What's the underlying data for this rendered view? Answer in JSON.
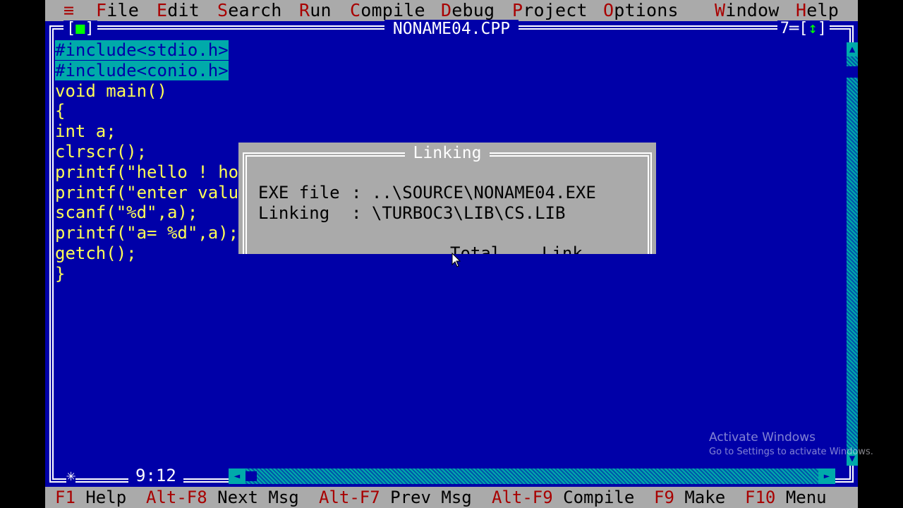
{
  "menu": {
    "system": "≡",
    "items": [
      {
        "hot": "F",
        "rest": "ile"
      },
      {
        "hot": "E",
        "rest": "dit"
      },
      {
        "hot": "S",
        "rest": "earch"
      },
      {
        "hot": "R",
        "rest": "un"
      },
      {
        "hot": "C",
        "rest": "ompile"
      },
      {
        "hot": "D",
        "rest": "ebug"
      },
      {
        "hot": "P",
        "rest": "roject"
      },
      {
        "hot": "O",
        "rest": "ptions"
      },
      {
        "hot": "W",
        "rest": "indow"
      },
      {
        "hot": "H",
        "rest": "elp"
      }
    ]
  },
  "editor": {
    "title": "NONAME04.CPP",
    "close_box": "■",
    "window_number": "7",
    "zoom_icon": "↕",
    "cursor_position": "9:12",
    "code_lines": [
      "#include<stdio.h>",
      "#include<conio.h>",
      "void main()",
      "{",
      "int a;",
      "clrscr();",
      "printf(\"hello ! ho",
      "printf(\"enter valu",
      "scanf(\"%d\",a);",
      "printf(\"a= %d\",a);",
      "getch();",
      "}"
    ]
  },
  "dialog": {
    "title": "Linking",
    "exe_label": "EXE file",
    "exe_value": "..\\SOURCE\\NONAME04.EXE",
    "linking_label": "Linking",
    "linking_value": "\\TURBOC3\\LIB\\CS.LIB",
    "separator": ":",
    "col_total": "Total",
    "col_link": "Link"
  },
  "statusbar": [
    {
      "key": "F1",
      "label": "Help"
    },
    {
      "key": "Alt-F8",
      "label": "Next Msg"
    },
    {
      "key": "Alt-F7",
      "label": "Prev Msg"
    },
    {
      "key": "Alt-F9",
      "label": "Compile"
    },
    {
      "key": "F9",
      "label": "Make"
    },
    {
      "key": "F10",
      "label": "Menu"
    }
  ],
  "watermark": {
    "line1": "Activate Windows",
    "line2": "Go to Settings to activate Windows."
  },
  "colors": {
    "background": "#0000a8",
    "menu_bg": "#aaaaaa",
    "hotkey": "#a80000",
    "code_text": "#ffff55",
    "string_text": "#ff5555",
    "selection": "#00aaaa"
  }
}
